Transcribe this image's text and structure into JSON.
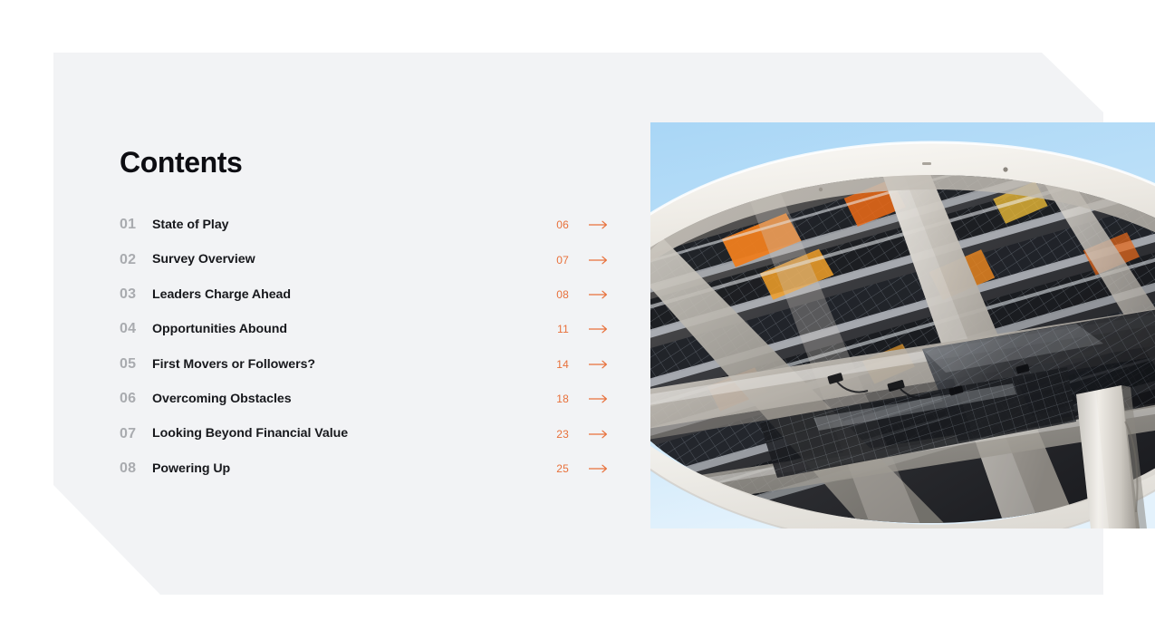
{
  "slide": {
    "title": "Contents",
    "background_color": "#ffffff",
    "card_color": "#f2f3f5",
    "accent_color": "#e8703a",
    "index_color": "#a9abaf",
    "label_color": "#17181c"
  },
  "toc": {
    "arrow_icon": "arrow-right-icon",
    "items": [
      {
        "index": "01",
        "label": "State of Play",
        "page": "06",
        "arrow": "→"
      },
      {
        "index": "02",
        "label": "Survey Overview",
        "page": "07",
        "arrow": "→"
      },
      {
        "index": "03",
        "label": "Leaders Charge Ahead",
        "page": "08",
        "arrow": "→"
      },
      {
        "index": "04",
        "label": "Opportunities Abound",
        "page": "11",
        "arrow": "→"
      },
      {
        "index": "05",
        "label": "First Movers or Followers?",
        "page": "14",
        "arrow": "→"
      },
      {
        "index": "06",
        "label": "Overcoming Obstacles",
        "page": "18",
        "arrow": "→"
      },
      {
        "index": "07",
        "label": "Looking Beyond Financial Value",
        "page": "23",
        "arrow": "→"
      },
      {
        "index": "08",
        "label": "Powering Up",
        "page": "25",
        "arrow": "→"
      }
    ]
  },
  "photo": {
    "subject": "solar-canopy-underside-photo",
    "description": "Upward view of a large elliptical solar carport canopy with a white rim, dark photovoltaic panels, metal struts and orange accents against a clear blue sky",
    "sky_color": "#bfe0f7",
    "rim_color": "#f0eee9",
    "panel_color": "#2a2b2f",
    "accent_color": "#e8701f"
  }
}
